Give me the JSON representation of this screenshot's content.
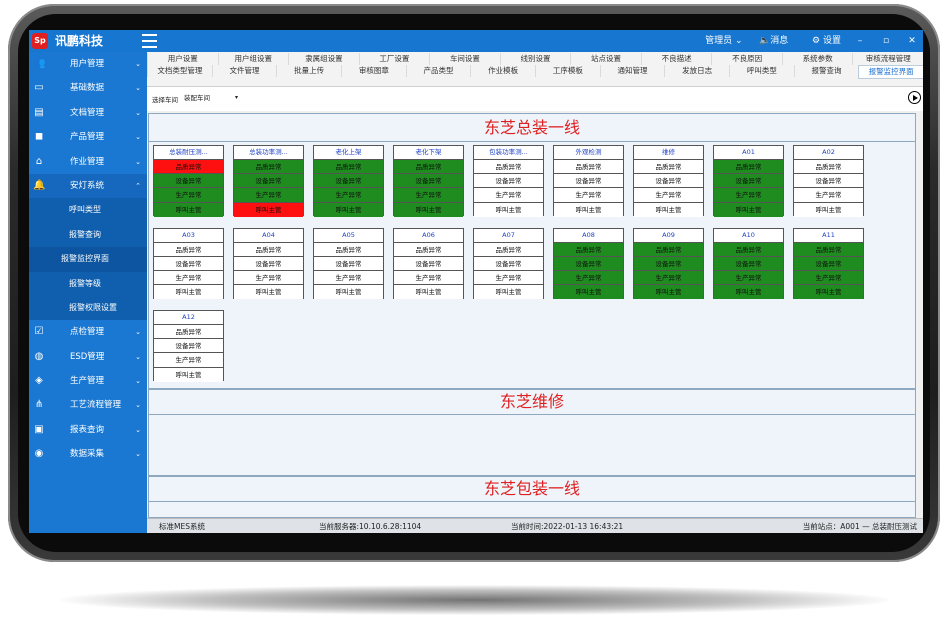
{
  "app": {
    "logo_text": "Sp",
    "name": "讯鹏科技"
  },
  "topbar": {
    "user": "管理员",
    "messages": "消息",
    "settings": "设置",
    "minimize": "–",
    "restore": "▫",
    "close": "✕"
  },
  "sidebar": {
    "items": [
      {
        "label": "用户管理",
        "icon": "users-icon"
      },
      {
        "label": "基础数据",
        "icon": "monitor-icon"
      },
      {
        "label": "文档管理",
        "icon": "document-icon"
      },
      {
        "label": "产品管理",
        "icon": "box-icon"
      },
      {
        "label": "作业管理",
        "icon": "factory-icon"
      },
      {
        "label": "安灯系统",
        "icon": "bell-icon"
      },
      {
        "label": "点检管理",
        "icon": "checklist-icon"
      },
      {
        "label": "ESD管理",
        "icon": "globe-icon"
      },
      {
        "label": "生产管理",
        "icon": "layers-icon"
      },
      {
        "label": "工艺流程管理",
        "icon": "flow-icon"
      },
      {
        "label": "报表查询",
        "icon": "report-icon"
      },
      {
        "label": "数据采集",
        "icon": "gauge-icon"
      }
    ],
    "sub_items": [
      "呼叫类型",
      "报警查询",
      "报警监控界面",
      "报警等级",
      "报警权限设置"
    ]
  },
  "tabs": {
    "row1": [
      "用户设置",
      "用户组设置",
      "隶属组设置",
      "工厂设置",
      "车间设置",
      "线别设置",
      "站点设置",
      "不良描述",
      "不良原因",
      "系统参数",
      "审核流程管理"
    ],
    "row2": [
      "文档类型管理",
      "文件管理",
      "批量上传",
      "审核图章",
      "产品类型",
      "作业模板",
      "工序模板",
      "通知管理",
      "发放日志",
      "呼叫类型",
      "报警查询",
      "报警监控界面"
    ]
  },
  "toolbar": {
    "workshop_label": "选择车间",
    "workshop_value": "装配车间"
  },
  "row_labels": [
    "品质异常",
    "设备异常",
    "生产异常",
    "呼叫主管"
  ],
  "sections": [
    {
      "title": "东芝总装一线"
    },
    {
      "title": "东芝维修"
    },
    {
      "title": "东芝包装一线"
    }
  ],
  "stations": [
    {
      "name": "总装耐压测...",
      "states": [
        "r",
        "g",
        "g",
        "g"
      ]
    },
    {
      "name": "总装功率测...",
      "states": [
        "g",
        "g",
        "g",
        "r"
      ]
    },
    {
      "name": "老化上架",
      "states": [
        "g",
        "g",
        "g",
        "g"
      ]
    },
    {
      "name": "老化下架",
      "states": [
        "g",
        "g",
        "g",
        "g"
      ]
    },
    {
      "name": "包装功率测...",
      "states": [
        "w",
        "w",
        "w",
        "w"
      ]
    },
    {
      "name": "外观检测",
      "states": [
        "w",
        "w",
        "w",
        "w"
      ]
    },
    {
      "name": "维修",
      "states": [
        "w",
        "w",
        "w",
        "w"
      ]
    },
    {
      "name": "A01",
      "states": [
        "g",
        "g",
        "g",
        "g"
      ]
    },
    {
      "name": "A02",
      "states": [
        "w",
        "w",
        "w",
        "w"
      ]
    },
    {
      "name": "A03",
      "states": [
        "w",
        "w",
        "w",
        "w"
      ]
    },
    {
      "name": "A04",
      "states": [
        "w",
        "w",
        "w",
        "w"
      ]
    },
    {
      "name": "A05",
      "states": [
        "w",
        "w",
        "w",
        "w"
      ]
    },
    {
      "name": "A06",
      "states": [
        "w",
        "w",
        "w",
        "w"
      ]
    },
    {
      "name": "A07",
      "states": [
        "w",
        "w",
        "w",
        "w"
      ]
    },
    {
      "name": "A08",
      "states": [
        "g",
        "g",
        "g",
        "g"
      ]
    },
    {
      "name": "A09",
      "states": [
        "g",
        "g",
        "g",
        "g"
      ]
    },
    {
      "name": "A10",
      "states": [
        "g",
        "g",
        "g",
        "g"
      ]
    },
    {
      "name": "A11",
      "states": [
        "g",
        "g",
        "g",
        "g"
      ]
    },
    {
      "name": "A12",
      "states": [
        "w",
        "w",
        "w",
        "w"
      ]
    }
  ],
  "colors": {
    "green": "#1e8c1e",
    "red": "#ff1010",
    "accent": "#1776d0"
  },
  "status": {
    "system": "标准MES系统",
    "server": "当前服务器:10.10.6.28:1104",
    "time": "当前时间:2022-01-13 16:43:21",
    "station": "当前站点：A001 — 总装耐压测试"
  }
}
